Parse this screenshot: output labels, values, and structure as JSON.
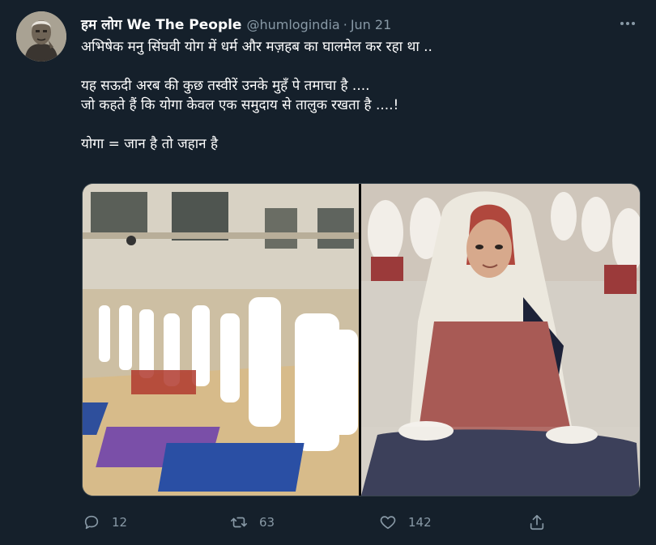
{
  "tweet": {
    "author_name": "हम लोग We The People",
    "handle": "@humlogindia",
    "separator": "·",
    "date": "Jun 21",
    "lines": [
      "अभिषेक मनु सिंघवी योग में धर्म और मज़हब का घालमेल कर रहा था ..",
      "यह सऊदी अरब की कुछ तस्वीरें उनके मुहँ पे तमाचा है ....",
      "जो कहते हैं कि योगा केवल एक समुदाय से तालुक रखता है ....!",
      "योगा = जान है तो जहान है"
    ]
  },
  "actions": {
    "reply_count": "12",
    "retweet_count": "63",
    "like_count": "142"
  },
  "icons": {
    "reply": "reply-icon",
    "retweet": "retweet-icon",
    "like": "heart-icon",
    "share": "share-icon",
    "more": "more-options-icon"
  },
  "colors": {
    "background": "#15202b",
    "secondary_text": "#8899a6",
    "border": "#38444d"
  }
}
